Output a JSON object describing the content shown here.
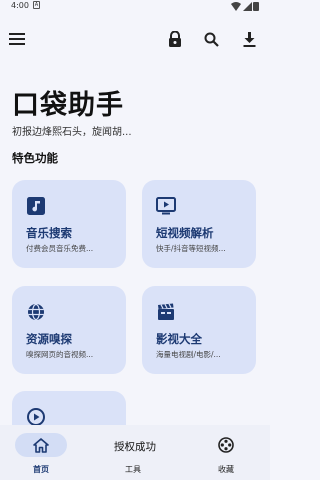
{
  "status_bar": {
    "time": "4:00",
    "notification_glyph": "A"
  },
  "app": {
    "title": "口袋助手",
    "subtitle": "初报边烽熙石头，旋闻胡...",
    "section_title": "特色功能"
  },
  "cards": [
    {
      "title": "音乐搜索",
      "desc": "付费会员音乐免费...",
      "icon": "music-note-icon"
    },
    {
      "title": "短视频解析",
      "desc": "快手/抖音等短视频...",
      "icon": "tv-play-icon"
    },
    {
      "title": "资源嗅探",
      "desc": "嗅探网页的音视频...",
      "icon": "globe-icon"
    },
    {
      "title": "影视大全",
      "desc": "海量电视剧/电影/...",
      "icon": "clapperboard-icon"
    },
    {
      "title": "",
      "desc": "",
      "icon": "play-circle-icon"
    }
  ],
  "bottom_nav": [
    {
      "label": "首页",
      "icon": "home-icon",
      "active": true
    },
    {
      "label": "工具",
      "icon": "tool-icon",
      "active": false
    },
    {
      "label": "收藏",
      "icon": "film-reel-icon",
      "active": false
    }
  ],
  "toast": "授权成功",
  "colors": {
    "card_bg": "#dae2f8",
    "accent": "#1d3a73",
    "background": "#f4f5fb",
    "nav_bg": "#eef0f8"
  }
}
